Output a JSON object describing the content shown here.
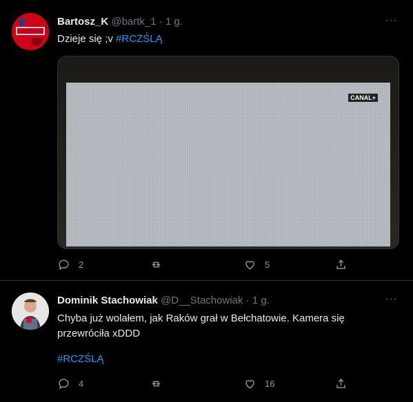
{
  "tweets": [
    {
      "name": "Bartosz_K",
      "handle": "@bartk_1",
      "time": "· 1 g.",
      "text": "Dzieje się ;v ",
      "hashtag": "#RCZŚLĄ",
      "media": {
        "watermark": "CANAL+"
      },
      "replies": "2",
      "retweets": "",
      "likes": "5"
    },
    {
      "name": "Dominik Stachowiak",
      "handle": "@D__Stachowiak",
      "time": "· 1 g.",
      "text": "Chyba już wolałem, jak Raków grał w Bełchatowie. Kamera się przewróciła xDDD",
      "hashtag": "#RCZŚLĄ",
      "replies": "4",
      "retweets": "",
      "likes": "16"
    }
  ],
  "more_label": "···",
  "colors": {
    "link": "#1d9bf0",
    "muted": "#6e767d",
    "background": "#000000"
  }
}
